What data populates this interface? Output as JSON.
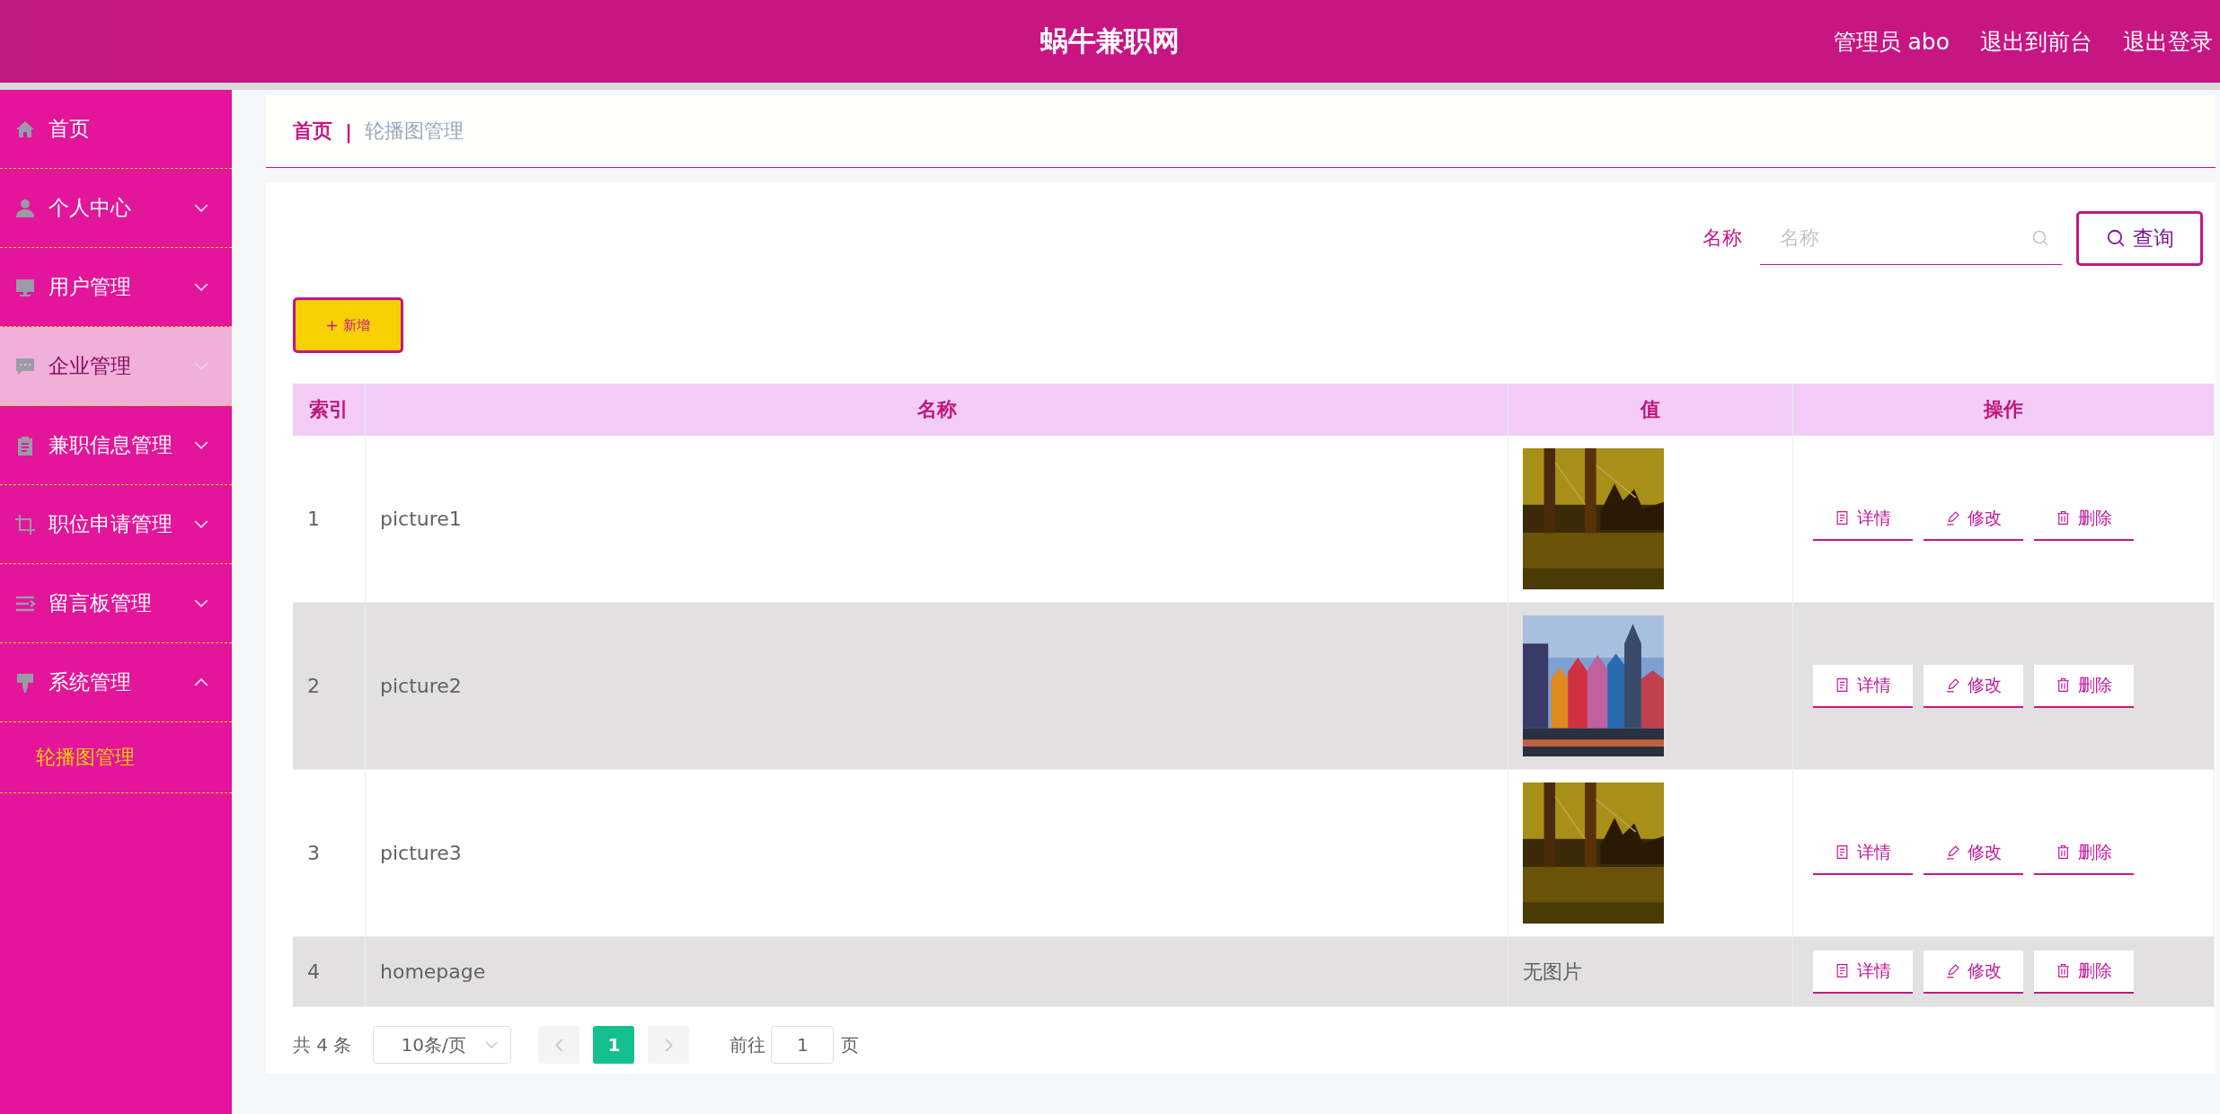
{
  "header": {
    "title": "蜗牛兼职网",
    "links": [
      "管理员 abo",
      "退出到前台",
      "退出登录"
    ]
  },
  "sidebar": {
    "items": [
      {
        "label": "首页",
        "kind": "link",
        "selected": false
      },
      {
        "label": "个人中心",
        "kind": "group",
        "selected": false,
        "expanded": false
      },
      {
        "label": "用户管理",
        "kind": "group",
        "selected": false,
        "expanded": false
      },
      {
        "label": "企业管理",
        "kind": "group",
        "selected": true,
        "expanded": false
      },
      {
        "label": "兼职信息管理",
        "kind": "group",
        "selected": false,
        "expanded": false
      },
      {
        "label": "职位申请管理",
        "kind": "group",
        "selected": false,
        "expanded": false
      },
      {
        "label": "留言板管理",
        "kind": "group",
        "selected": false,
        "expanded": false
      },
      {
        "label": "系统管理",
        "kind": "group",
        "selected": false,
        "expanded": true,
        "children": [
          {
            "label": "轮播图管理",
            "selected": true
          }
        ]
      }
    ]
  },
  "breadcrumb": {
    "items": [
      "首页",
      "轮播图管理"
    ],
    "separator": "|"
  },
  "search": {
    "label": "名称",
    "placeholder": "名称",
    "button": "查询"
  },
  "add_button": "新增",
  "table": {
    "columns": [
      "索引",
      "名称",
      "值",
      "操作"
    ],
    "rows": [
      {
        "index": "1",
        "name": "picture1",
        "value": {
          "kind": "picture"
        },
        "actions": [
          "详情",
          "修改",
          "删除"
        ]
      },
      {
        "index": "2",
        "name": "picture2",
        "value": {
          "kind": "picture"
        },
        "actions": [
          "详情",
          "修改",
          "删除"
        ]
      },
      {
        "index": "3",
        "name": "picture3",
        "value": {
          "kind": "picture"
        },
        "actions": [
          "详情",
          "修改",
          "删除"
        ]
      },
      {
        "index": "4",
        "name": "homepage",
        "value": {
          "kind": "text",
          "text": "无图片"
        },
        "actions": [
          "详情",
          "修改",
          "删除"
        ]
      }
    ]
  },
  "pagination": {
    "total": "共 4 条",
    "page_size": "10条/页",
    "pages": [
      {
        "label": "1",
        "selected": true
      }
    ],
    "goto_label": "前往",
    "goto_value": "1",
    "goto_suffix": "页"
  }
}
